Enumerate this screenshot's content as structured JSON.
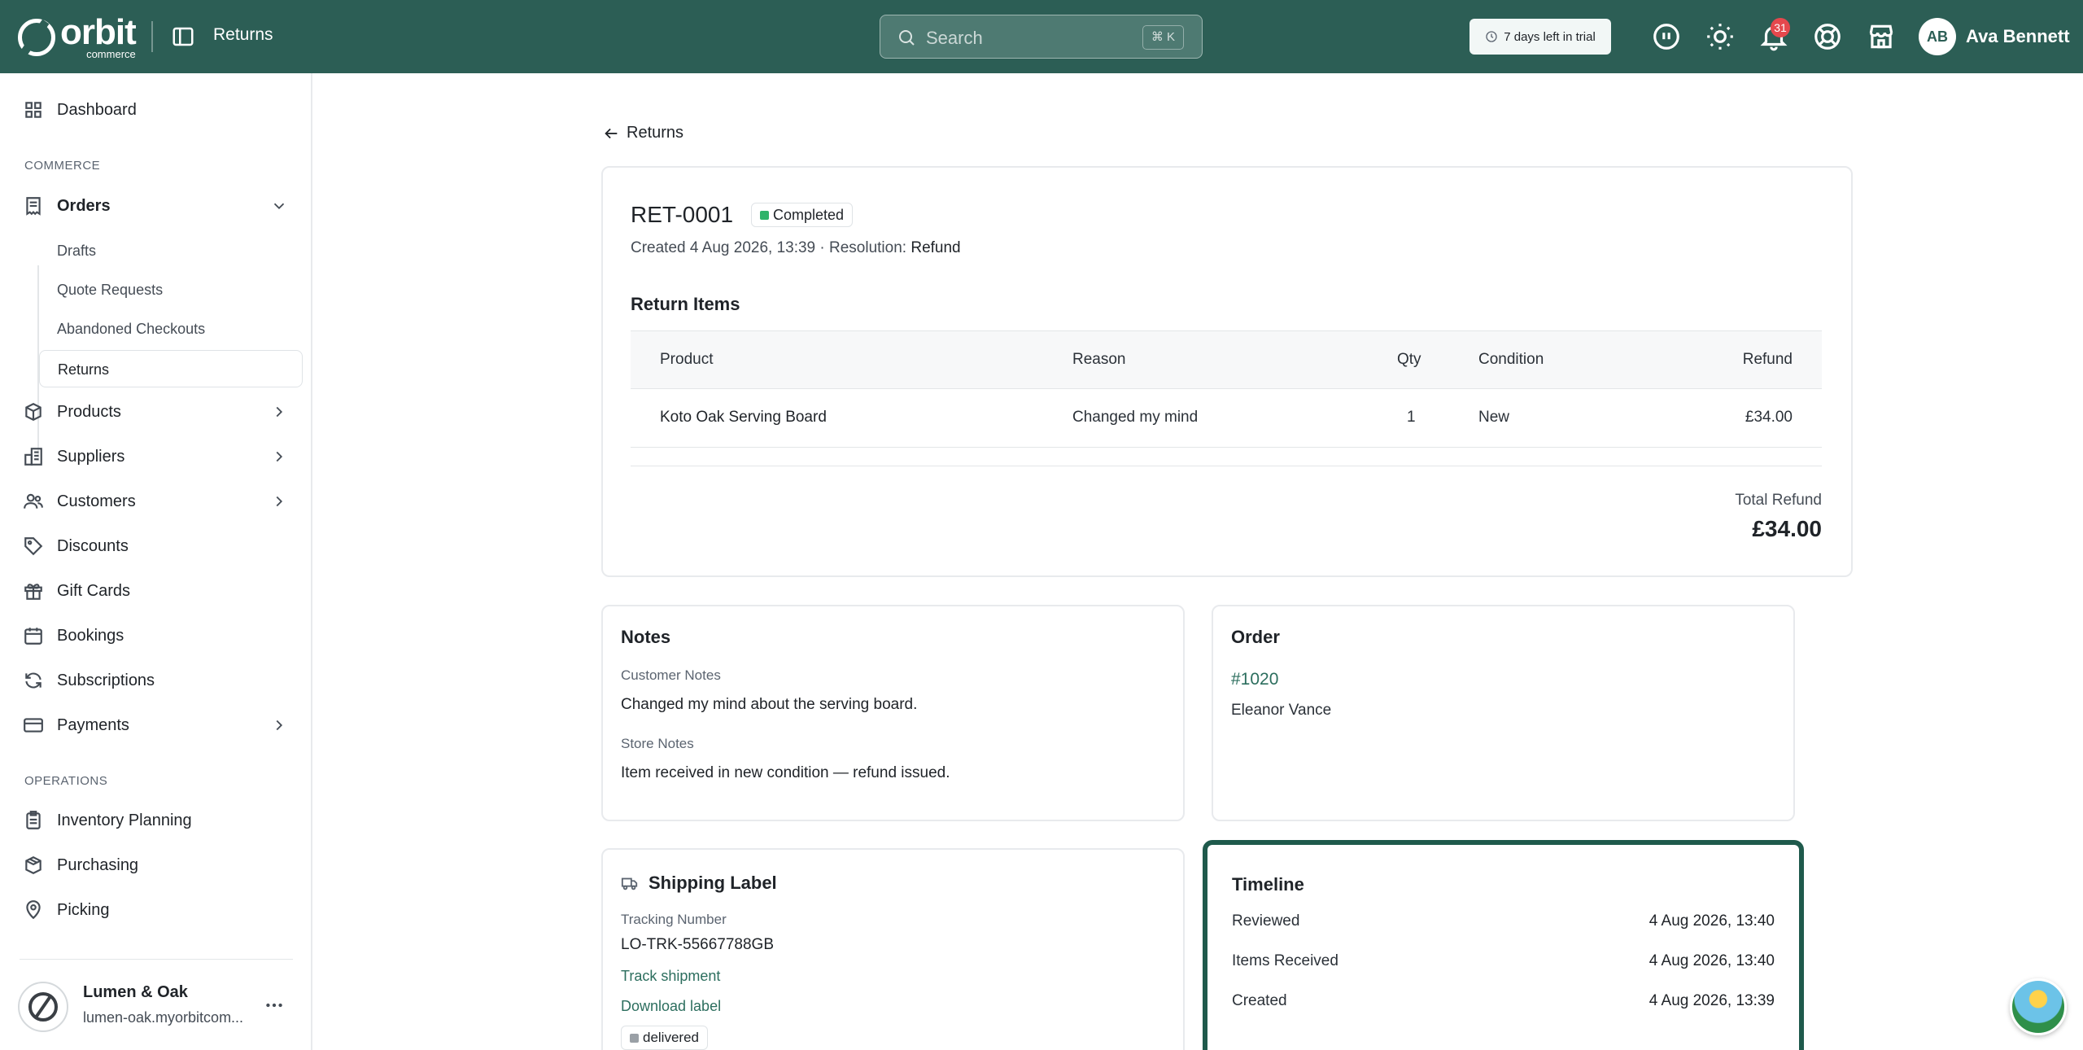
{
  "topbar": {
    "logo_word": "orbit",
    "logo_sub": "commerce",
    "page_title": "Returns",
    "search_placeholder": "Search",
    "search_shortcut": "⌘ K",
    "trial_text": "7 days left in trial",
    "notification_count": "31",
    "user_initials": "AB",
    "user_name": "Ava Bennett"
  },
  "sidebar": {
    "dashboard": "Dashboard",
    "section_commerce": "COMMERCE",
    "orders": "Orders",
    "orders_sub": [
      "Drafts",
      "Quote Requests",
      "Abandoned Checkouts",
      "Returns"
    ],
    "products": "Products",
    "suppliers": "Suppliers",
    "customers": "Customers",
    "discounts": "Discounts",
    "gift_cards": "Gift Cards",
    "bookings": "Bookings",
    "subscriptions": "Subscriptions",
    "payments": "Payments",
    "section_operations": "OPERATIONS",
    "inventory_planning": "Inventory Planning",
    "purchasing": "Purchasing",
    "picking": "Picking",
    "store_name": "Lumen & Oak",
    "store_url": "lumen-oak.myorbitcom..."
  },
  "main": {
    "back_label": "Returns",
    "return_id": "RET-0001",
    "status": "Completed",
    "created_text": "Created 4 Aug 2026, 13:39 · Resolution:",
    "resolution": "Refund",
    "items_title": "Return Items",
    "columns": {
      "product": "Product",
      "reason": "Reason",
      "qty": "Qty",
      "condition": "Condition",
      "refund": "Refund"
    },
    "items": [
      {
        "product": "Koto Oak Serving Board",
        "reason": "Changed my mind",
        "qty": "1",
        "condition": "New",
        "refund": "£34.00"
      }
    ],
    "total_label": "Total Refund",
    "total_value": "£34.00",
    "notes": {
      "title": "Notes",
      "customer_label": "Customer Notes",
      "customer_value": "Changed my mind about the serving board.",
      "store_label": "Store Notes",
      "store_value": "Item received in new condition — refund issued."
    },
    "order": {
      "title": "Order",
      "number": "#1020",
      "customer": "Eleanor Vance"
    },
    "shipping": {
      "title": "Shipping Label",
      "tracking_label": "Tracking Number",
      "tracking_value": "LO-TRK-55667788GB",
      "track_link": "Track shipment",
      "download_link": "Download label",
      "status": "delivered"
    },
    "timeline": {
      "title": "Timeline",
      "events": [
        {
          "label": "Reviewed",
          "date": "4 Aug 2026, 13:40"
        },
        {
          "label": "Items Received",
          "date": "4 Aug 2026, 13:40"
        },
        {
          "label": "Created",
          "date": "4 Aug 2026, 13:39"
        }
      ]
    }
  },
  "colors": {
    "brand": "#2c5e55",
    "status_completed": "#2fb36a",
    "status_delivered": "#9aa0a6",
    "link": "#2c6e5e",
    "badge_red": "#e5484d"
  }
}
